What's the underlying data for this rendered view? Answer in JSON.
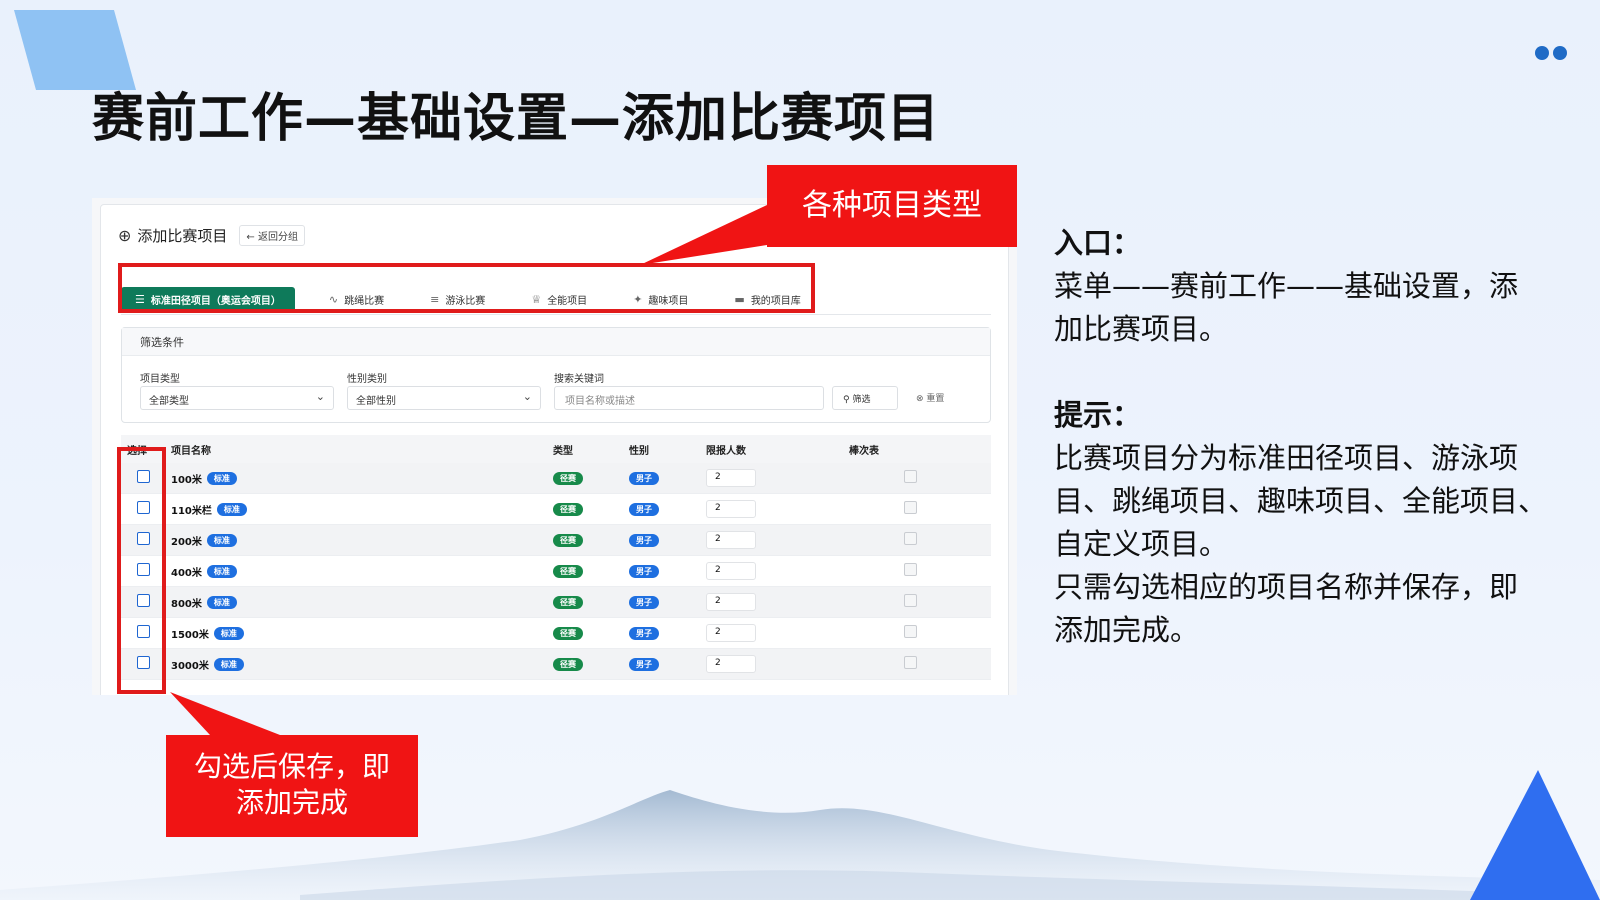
{
  "slide": {
    "title": "赛前工作—基础设置—添加比赛项目"
  },
  "panel": {
    "header": {
      "title": "添加比赛项目",
      "back_label": "返回分组"
    },
    "tabs": [
      {
        "label": "标准田径项目（奥运会项目）",
        "icon": "list-icon",
        "glyph": "☰",
        "active": true
      },
      {
        "label": "跳绳比赛",
        "icon": "activity-icon",
        "glyph": "∿",
        "active": false
      },
      {
        "label": "游泳比赛",
        "icon": "waves-icon",
        "glyph": "≡",
        "active": false
      },
      {
        "label": "全能项目",
        "icon": "trophy-icon",
        "glyph": "♕",
        "active": false
      },
      {
        "label": "趣味项目",
        "icon": "sparkle-icon",
        "glyph": "✦",
        "active": false
      },
      {
        "label": "我的项目库",
        "icon": "folder-icon",
        "glyph": "▬",
        "active": false
      }
    ],
    "filter": {
      "title": "筛选条件",
      "type_label": "项目类型",
      "type_value": "全部类型",
      "gender_label": "性别类别",
      "gender_value": "全部性别",
      "keyword_label": "搜索关键词",
      "keyword_placeholder": "项目名称或描述",
      "search_label": "筛选",
      "reset_label": "重置"
    },
    "table": {
      "headers": {
        "select": "选择",
        "name": "项目名称",
        "type": "类型",
        "gender": "性别",
        "limit": "限报人数",
        "relay": "棒次表"
      },
      "rows": [
        {
          "name": "100米",
          "tag": "标准",
          "type": "径赛",
          "gender": "男子",
          "limit": "2"
        },
        {
          "name": "110米栏",
          "tag": "标准",
          "type": "径赛",
          "gender": "男子",
          "limit": "2"
        },
        {
          "name": "200米",
          "tag": "标准",
          "type": "径赛",
          "gender": "男子",
          "limit": "2"
        },
        {
          "name": "400米",
          "tag": "标准",
          "type": "径赛",
          "gender": "男子",
          "limit": "2"
        },
        {
          "name": "800米",
          "tag": "标准",
          "type": "径赛",
          "gender": "男子",
          "limit": "2"
        },
        {
          "name": "1500米",
          "tag": "标准",
          "type": "径赛",
          "gender": "男子",
          "limit": "2"
        },
        {
          "name": "3000米",
          "tag": "标准",
          "type": "径赛",
          "gender": "男子",
          "limit": "2"
        }
      ]
    }
  },
  "annotations": {
    "tabs_callout": "各种项目类型",
    "save_callout_line1": "勾选后保存，即",
    "save_callout_line2": "添加完成"
  },
  "side_text": {
    "entry_heading": "入口：",
    "entry_line1": "菜单——赛前工作——基础设置，添",
    "entry_line2": "加比赛项目。",
    "tip_heading": "提示：",
    "tip_line1": "比赛项目分为标准田径项目、游泳项",
    "tip_line2": "目、跳绳项目、趣味项目、全能项目、",
    "tip_line3": "自定义项目。",
    "tip_line4": "只需勾选相应的项目名称并保存，即",
    "tip_line5": "添加完成。"
  },
  "colors": {
    "callout_red": "#f01414",
    "active_tab_green": "#0e7a5a",
    "tag_blue": "#1e6fe0",
    "type_green": "#178a4a",
    "accent_blue": "#1f6bc6"
  }
}
